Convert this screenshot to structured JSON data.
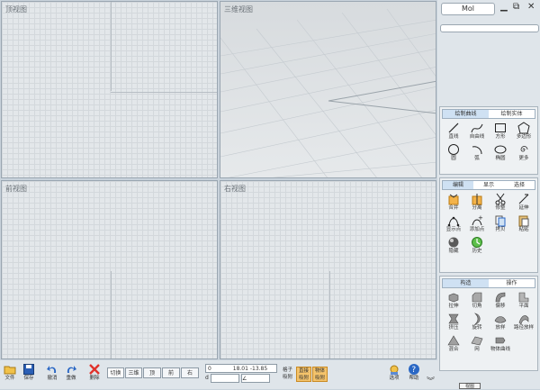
{
  "viewports": {
    "top": "顶视图",
    "perspective": "三维视图",
    "front": "前视图",
    "right": "右视图"
  },
  "panel": {
    "command_value": "Mol",
    "curves_group": {
      "tabs": [
        "绘制曲线",
        "绘制实体"
      ],
      "tools": [
        "直线",
        "自由线",
        "方形",
        "多边形",
        "圆",
        "弧",
        "椭圆",
        "更多"
      ]
    },
    "edit_group": {
      "tabs": [
        "编辑",
        "显示",
        "选择"
      ],
      "tools": [
        "合并",
        "分离",
        "修整",
        "延伸",
        "显示点",
        "添加点",
        "拷贝",
        "粘贴",
        "隐藏",
        "历史"
      ]
    },
    "construct_group": {
      "tabs": [
        "构造",
        "操作"
      ],
      "tools": [
        "拉伸",
        "切角",
        "偏移",
        "平面",
        "挤压",
        "旋转",
        "放样",
        "路径放样",
        "混合",
        "网",
        "物体曲线"
      ]
    }
  },
  "bottom": {
    "file": "文件",
    "save": "保存",
    "undo": "撤消",
    "redo": "重做",
    "delete": "删除",
    "views": [
      "切换",
      "三维",
      "顶",
      "前",
      "右"
    ],
    "coord_prefix": "0",
    "coord_value": "18.01 -13.85",
    "coord_d": "d",
    "snap_grid": "格子\n吸附",
    "snap_line": "直接\n吸附",
    "snap_object": "物体\n吸附",
    "options": "选项",
    "help": "帮助",
    "corner": "视图"
  },
  "colors": {
    "accent_tab": "#cfe1f3",
    "snap_on": "#f4c36b",
    "delete_icon": "#e0322b",
    "undo_icon": "#2a67c4"
  }
}
